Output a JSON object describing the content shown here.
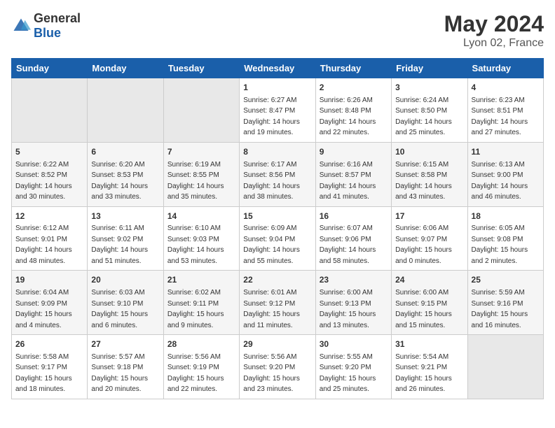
{
  "logo": {
    "general": "General",
    "blue": "Blue"
  },
  "title": "May 2024",
  "location": "Lyon 02, France",
  "days_of_week": [
    "Sunday",
    "Monday",
    "Tuesday",
    "Wednesday",
    "Thursday",
    "Friday",
    "Saturday"
  ],
  "weeks": [
    [
      {
        "day": "",
        "empty": true
      },
      {
        "day": "",
        "empty": true
      },
      {
        "day": "",
        "empty": true
      },
      {
        "day": "1",
        "sunrise": "6:27 AM",
        "sunset": "8:47 PM",
        "daylight": "14 hours and 19 minutes."
      },
      {
        "day": "2",
        "sunrise": "6:26 AM",
        "sunset": "8:48 PM",
        "daylight": "14 hours and 22 minutes."
      },
      {
        "day": "3",
        "sunrise": "6:24 AM",
        "sunset": "8:50 PM",
        "daylight": "14 hours and 25 minutes."
      },
      {
        "day": "4",
        "sunrise": "6:23 AM",
        "sunset": "8:51 PM",
        "daylight": "14 hours and 27 minutes."
      }
    ],
    [
      {
        "day": "5",
        "sunrise": "6:22 AM",
        "sunset": "8:52 PM",
        "daylight": "14 hours and 30 minutes."
      },
      {
        "day": "6",
        "sunrise": "6:20 AM",
        "sunset": "8:53 PM",
        "daylight": "14 hours and 33 minutes."
      },
      {
        "day": "7",
        "sunrise": "6:19 AM",
        "sunset": "8:55 PM",
        "daylight": "14 hours and 35 minutes."
      },
      {
        "day": "8",
        "sunrise": "6:17 AM",
        "sunset": "8:56 PM",
        "daylight": "14 hours and 38 minutes."
      },
      {
        "day": "9",
        "sunrise": "6:16 AM",
        "sunset": "8:57 PM",
        "daylight": "14 hours and 41 minutes."
      },
      {
        "day": "10",
        "sunrise": "6:15 AM",
        "sunset": "8:58 PM",
        "daylight": "14 hours and 43 minutes."
      },
      {
        "day": "11",
        "sunrise": "6:13 AM",
        "sunset": "9:00 PM",
        "daylight": "14 hours and 46 minutes."
      }
    ],
    [
      {
        "day": "12",
        "sunrise": "6:12 AM",
        "sunset": "9:01 PM",
        "daylight": "14 hours and 48 minutes."
      },
      {
        "day": "13",
        "sunrise": "6:11 AM",
        "sunset": "9:02 PM",
        "daylight": "14 hours and 51 minutes."
      },
      {
        "day": "14",
        "sunrise": "6:10 AM",
        "sunset": "9:03 PM",
        "daylight": "14 hours and 53 minutes."
      },
      {
        "day": "15",
        "sunrise": "6:09 AM",
        "sunset": "9:04 PM",
        "daylight": "14 hours and 55 minutes."
      },
      {
        "day": "16",
        "sunrise": "6:07 AM",
        "sunset": "9:06 PM",
        "daylight": "14 hours and 58 minutes."
      },
      {
        "day": "17",
        "sunrise": "6:06 AM",
        "sunset": "9:07 PM",
        "daylight": "15 hours and 0 minutes."
      },
      {
        "day": "18",
        "sunrise": "6:05 AM",
        "sunset": "9:08 PM",
        "daylight": "15 hours and 2 minutes."
      }
    ],
    [
      {
        "day": "19",
        "sunrise": "6:04 AM",
        "sunset": "9:09 PM",
        "daylight": "15 hours and 4 minutes."
      },
      {
        "day": "20",
        "sunrise": "6:03 AM",
        "sunset": "9:10 PM",
        "daylight": "15 hours and 6 minutes."
      },
      {
        "day": "21",
        "sunrise": "6:02 AM",
        "sunset": "9:11 PM",
        "daylight": "15 hours and 9 minutes."
      },
      {
        "day": "22",
        "sunrise": "6:01 AM",
        "sunset": "9:12 PM",
        "daylight": "15 hours and 11 minutes."
      },
      {
        "day": "23",
        "sunrise": "6:00 AM",
        "sunset": "9:13 PM",
        "daylight": "15 hours and 13 minutes."
      },
      {
        "day": "24",
        "sunrise": "6:00 AM",
        "sunset": "9:15 PM",
        "daylight": "15 hours and 15 minutes."
      },
      {
        "day": "25",
        "sunrise": "5:59 AM",
        "sunset": "9:16 PM",
        "daylight": "15 hours and 16 minutes."
      }
    ],
    [
      {
        "day": "26",
        "sunrise": "5:58 AM",
        "sunset": "9:17 PM",
        "daylight": "15 hours and 18 minutes."
      },
      {
        "day": "27",
        "sunrise": "5:57 AM",
        "sunset": "9:18 PM",
        "daylight": "15 hours and 20 minutes."
      },
      {
        "day": "28",
        "sunrise": "5:56 AM",
        "sunset": "9:19 PM",
        "daylight": "15 hours and 22 minutes."
      },
      {
        "day": "29",
        "sunrise": "5:56 AM",
        "sunset": "9:20 PM",
        "daylight": "15 hours and 23 minutes."
      },
      {
        "day": "30",
        "sunrise": "5:55 AM",
        "sunset": "9:20 PM",
        "daylight": "15 hours and 25 minutes."
      },
      {
        "day": "31",
        "sunrise": "5:54 AM",
        "sunset": "9:21 PM",
        "daylight": "15 hours and 26 minutes."
      },
      {
        "day": "",
        "empty": true
      }
    ]
  ],
  "labels": {
    "sunrise": "Sunrise:",
    "sunset": "Sunset:",
    "daylight": "Daylight:"
  }
}
